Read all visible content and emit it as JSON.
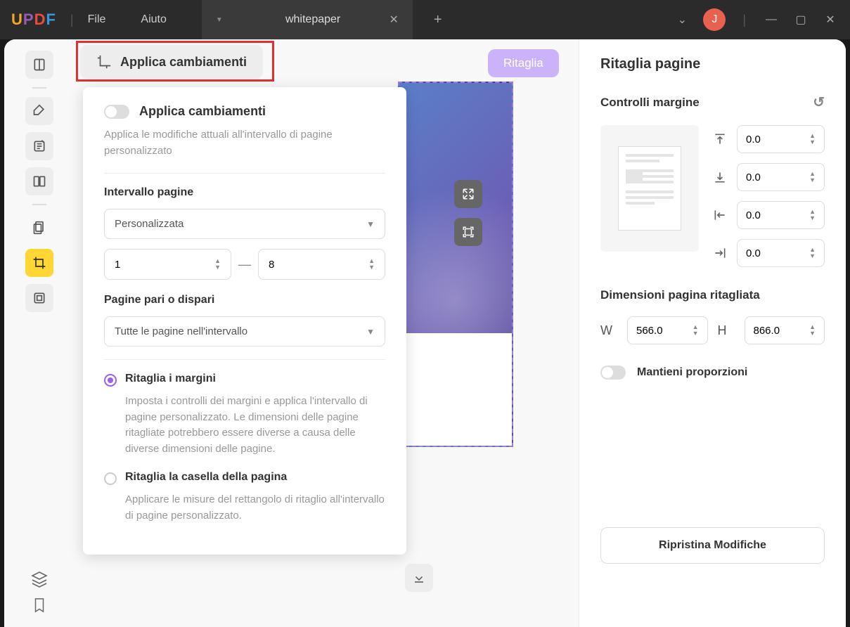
{
  "titlebar": {
    "menu": {
      "file": "File",
      "help": "Aiuto"
    },
    "tab": {
      "title": "whitepaper"
    },
    "avatar": "J"
  },
  "applyBar": {
    "label": "Applica cambiamenti"
  },
  "ritagliaBtn": "Ritaglia",
  "popup": {
    "toggleTitle": "Applica cambiamenti",
    "toggleDesc": "Applica le modifiche attuali all'intervallo di pagine personalizzato",
    "rangeLabel": "Intervallo pagine",
    "rangeSelect": "Personalizzata",
    "rangeFrom": "1",
    "rangeTo": "8",
    "oddEvenLabel": "Pagine pari o dispari",
    "oddEvenSelect": "Tutte le pagine nell'intervallo",
    "radio1Label": "Ritaglia i margini",
    "radio1Desc": "Imposta i controlli dei margini e applica l'intervallo di pagine personalizzato. Le dimensioni delle pagine ritagliate potrebbero essere diverse a causa delle diverse dimensioni delle pagine.",
    "radio2Label": "Ritaglia la casella della pagina",
    "radio2Desc": "Applicare le misure del rettangolo di ritaglio all'intervallo di pagine personalizzato."
  },
  "right": {
    "title": "Ritaglia pagine",
    "marginLabel": "Controlli margine",
    "margins": {
      "top": "0.0",
      "bottom": "0.0",
      "left": "0.0",
      "right": "0.0"
    },
    "dimLabel": "Dimensioni pagina ritagliata",
    "dimW": "W",
    "dimH": "H",
    "width": "566.0",
    "height": "866.0",
    "keepRatio": "Mantieni proporzioni",
    "resetBtn": "Ripristina Modifiche"
  }
}
